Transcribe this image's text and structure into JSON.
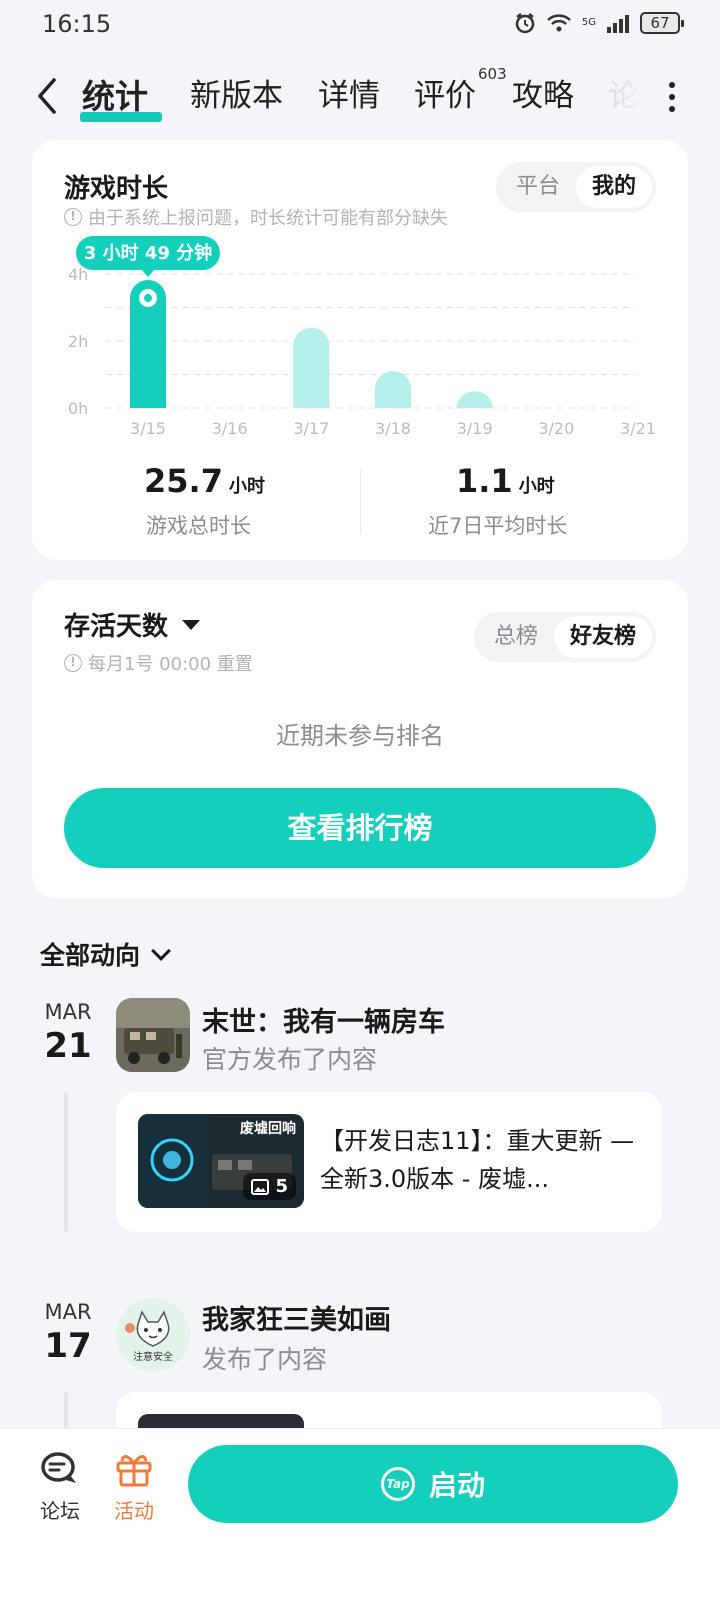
{
  "status": {
    "time": "16:15",
    "battery": "67",
    "network": "5G"
  },
  "nav": {
    "tabs": [
      {
        "label": "统计",
        "active": true
      },
      {
        "label": "新版本"
      },
      {
        "label": "详情"
      },
      {
        "label": "评价",
        "badge": "603"
      },
      {
        "label": "攻略"
      },
      {
        "label": "论"
      }
    ]
  },
  "playtime": {
    "title": "游戏时长",
    "hint": "由于系统上报问题，时长统计可能有部分缺失",
    "toggle": [
      "平台",
      "我的"
    ],
    "toggle_active": "我的",
    "tooltip": "3 小时 49 分钟",
    "total_value": "25.7",
    "total_unit": "小时",
    "total_label": "游戏总时长",
    "avg_value": "1.1",
    "avg_unit": "小时",
    "avg_label": "近7日平均时长"
  },
  "chart_data": {
    "type": "bar",
    "categories": [
      "3/15",
      "3/16",
      "3/17",
      "3/18",
      "3/19",
      "3/20",
      "3/21"
    ],
    "values": [
      3.82,
      0,
      2.4,
      1.1,
      0.5,
      0,
      0
    ],
    "y_ticks": [
      "0h",
      "2h",
      "4h"
    ],
    "ylim": [
      0,
      4
    ],
    "highlight_index": 0,
    "colors": {
      "highlight": "#15cfbd",
      "normal": "#b3f0e9"
    }
  },
  "survival": {
    "title": "存活天数",
    "hint": "每月1号 00:00 重置",
    "toggle": [
      "总榜",
      "好友榜"
    ],
    "toggle_active": "好友榜",
    "empty": "近期未参与排名",
    "button": "查看排行榜"
  },
  "feed": {
    "header": "全部动向",
    "items": [
      {
        "month": "MAR",
        "day": "21",
        "title": "末世：我有一辆房车",
        "subtitle": "官方发布了内容",
        "post_text": "【开发日志11】：重大更新 — 全新3.0版本 - 废墟...",
        "image_count": "5",
        "thumb_caption": "废墟回响"
      },
      {
        "month": "MAR",
        "day": "17",
        "title": "我家狂三美如画",
        "subtitle": "发布了内容",
        "avatar_text": "注意安全"
      }
    ]
  },
  "bottom": {
    "forum": "论坛",
    "activity": "活动",
    "launch": "启动",
    "launch_logo": "Tap"
  }
}
